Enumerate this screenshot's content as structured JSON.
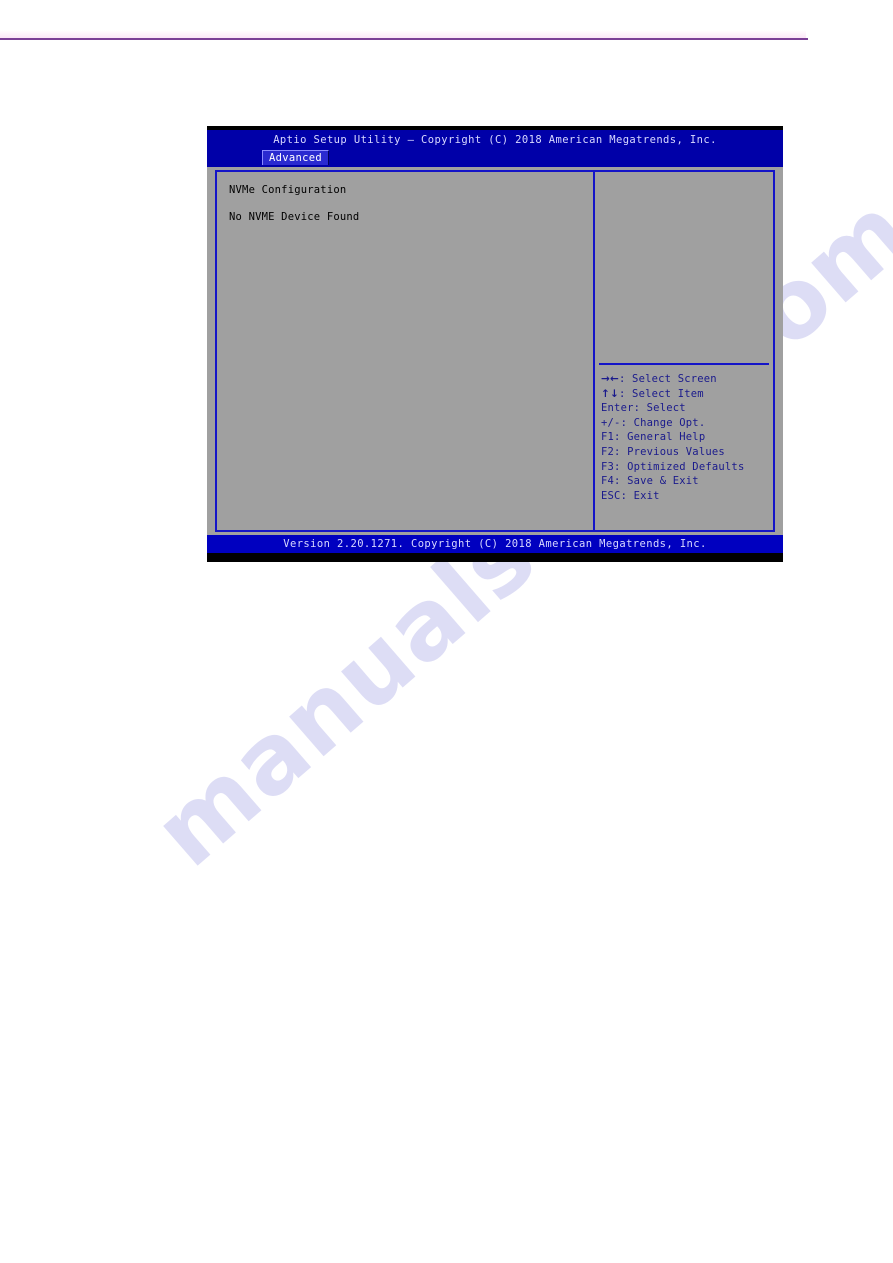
{
  "page": {
    "watermark": "manualshive.com",
    "rule_color": "#7b3f96"
  },
  "bios": {
    "title": "Aptio Setup Utility – Copyright (C) 2018 American Megatrends, Inc.",
    "tabs": [
      {
        "label": "Advanced",
        "selected": true
      }
    ],
    "main_panel": {
      "heading": "NVMe Configuration",
      "status": "No NVME Device Found"
    },
    "help_panel": {
      "keys": [
        {
          "glyph": "→←",
          "text": ": Select Screen"
        },
        {
          "glyph": "↑↓",
          "text": ": Select Item"
        },
        {
          "glyph": "",
          "text": "Enter: Select"
        },
        {
          "glyph": "",
          "text": "+/-: Change Opt."
        },
        {
          "glyph": "",
          "text": "F1: General Help"
        },
        {
          "glyph": "",
          "text": "F2: Previous Values"
        },
        {
          "glyph": "",
          "text": "F3: Optimized Defaults"
        },
        {
          "glyph": "",
          "text": "F4: Save & Exit"
        },
        {
          "glyph": "",
          "text": "ESC: Exit"
        }
      ]
    },
    "footer": "Version 2.20.1271. Copyright (C) 2018 American Megatrends, Inc.",
    "colors": {
      "titlebar": "#0000a8",
      "footer": "#0000c0",
      "panel_bg": "#a0a0a0",
      "border": "#1414c8",
      "help_text": "#1a1a8c"
    }
  }
}
